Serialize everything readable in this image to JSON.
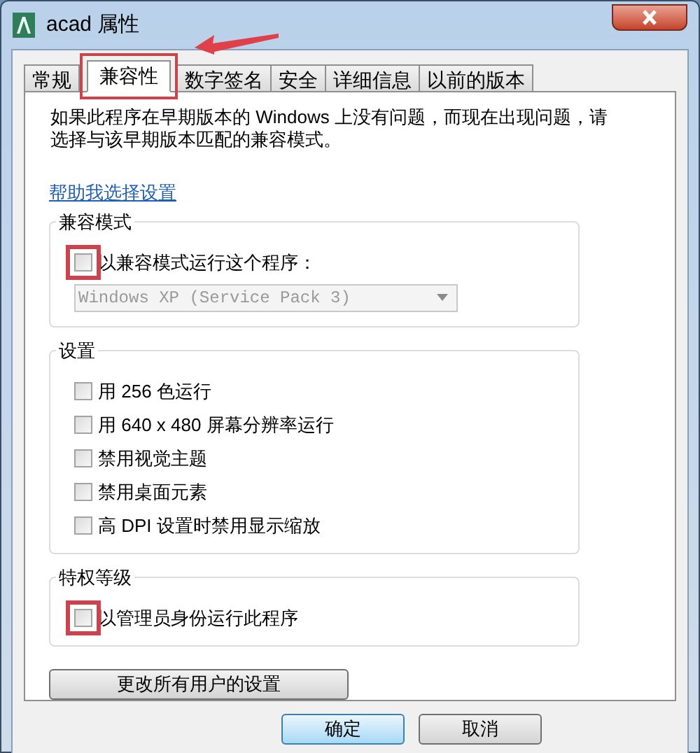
{
  "window": {
    "title": "acad 属性"
  },
  "tabs": [
    {
      "label": "常规",
      "selected": false,
      "highlighted": false
    },
    {
      "label": "兼容性",
      "selected": true,
      "highlighted": true
    },
    {
      "label": "数字签名",
      "selected": false,
      "highlighted": false
    },
    {
      "label": "安全",
      "selected": false,
      "highlighted": false
    },
    {
      "label": "详细信息",
      "selected": false,
      "highlighted": false
    },
    {
      "label": "以前的版本",
      "selected": false,
      "highlighted": false
    }
  ],
  "description": "如果此程序在早期版本的 Windows 上没有问题，而现在出现问题，请选择与该早期版本匹配的兼容模式。",
  "help_link": "帮助我选择设置",
  "groups": [
    {
      "title": "兼容模式",
      "items": [
        {
          "kind": "checkbox",
          "label": "以兼容模式运行这个程序：",
          "checked": false,
          "highlighted": true
        },
        {
          "kind": "dropdown",
          "value": "Windows XP (Service Pack 3)",
          "disabled": true
        }
      ]
    },
    {
      "title": "设置",
      "items": [
        {
          "kind": "checkbox",
          "label": "用 256 色运行",
          "checked": false,
          "highlighted": false
        },
        {
          "kind": "checkbox",
          "label": "用 640 x 480 屏幕分辨率运行",
          "checked": false,
          "highlighted": false
        },
        {
          "kind": "checkbox",
          "label": "禁用视觉主题",
          "checked": false,
          "highlighted": false
        },
        {
          "kind": "checkbox",
          "label": "禁用桌面元素",
          "checked": false,
          "highlighted": false
        },
        {
          "kind": "checkbox",
          "label": "高 DPI 设置时禁用显示缩放",
          "checked": false,
          "highlighted": false
        }
      ]
    },
    {
      "title": "特权等级",
      "items": [
        {
          "kind": "checkbox",
          "label": "以管理员身份运行此程序",
          "checked": false,
          "highlighted": true
        }
      ]
    }
  ],
  "all_users_button": "更改所有用户的设置",
  "buttons": [
    {
      "label": "确定",
      "default": true
    },
    {
      "label": "取消",
      "default": false
    }
  ]
}
